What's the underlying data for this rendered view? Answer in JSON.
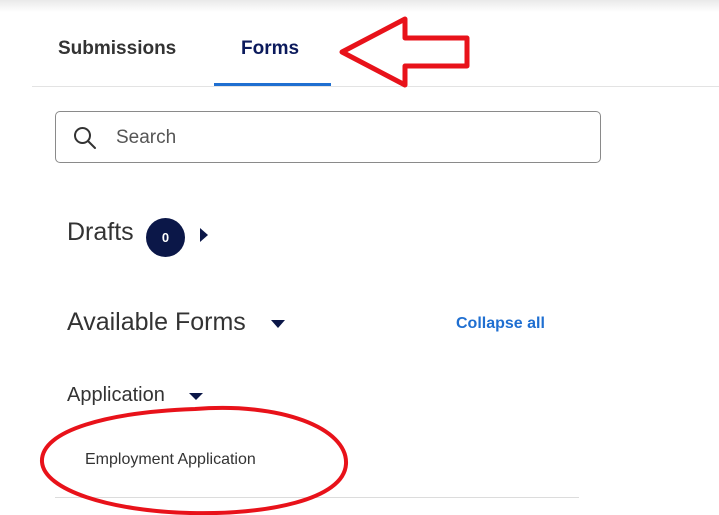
{
  "tabs": [
    {
      "label": "Submissions",
      "active": false
    },
    {
      "label": "Forms",
      "active": true
    }
  ],
  "search": {
    "placeholder": "Search",
    "value": ""
  },
  "drafts": {
    "label": "Drafts",
    "count": "0"
  },
  "available_forms": {
    "label": "Available Forms",
    "collapse_all_label": "Collapse all"
  },
  "categories": [
    {
      "label": "Application",
      "forms": [
        "Employment Application"
      ]
    }
  ],
  "colors": {
    "accent": "#1f6fd1",
    "navy": "#0b1748",
    "annotation_red": "#e8121a"
  },
  "annotations": {
    "arrow_color": "#e8121a",
    "ellipse_color": "#e8121a"
  }
}
